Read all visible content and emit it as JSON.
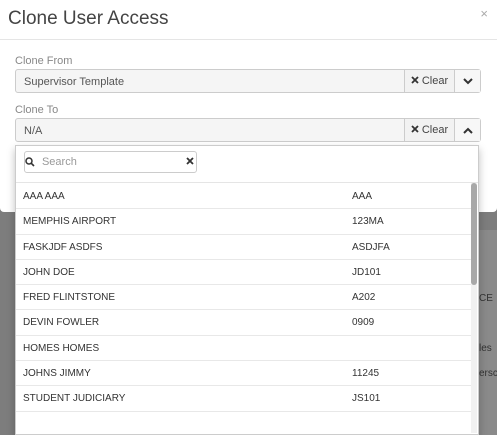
{
  "modal": {
    "title": "Clone User Access",
    "close_glyph": "×"
  },
  "clone_from": {
    "label": "Clone From",
    "value": "Supervisor Template",
    "clear_label": "Clear"
  },
  "clone_to": {
    "label": "Clone To",
    "value": "N/A",
    "clear_label": "Clear"
  },
  "dropdown": {
    "search_placeholder": "Search",
    "items": [
      {
        "name": "AAA AAA",
        "code": "AAA"
      },
      {
        "name": "MEMPHIS AIRPORT",
        "code": "123MA"
      },
      {
        "name": "FASKJDF ASDFS",
        "code": "ASDJFA"
      },
      {
        "name": "JOHN DOE",
        "code": "JD101"
      },
      {
        "name": "FRED FLINTSTONE",
        "code": "A202"
      },
      {
        "name": "DEVIN FOWLER",
        "code": "0909"
      },
      {
        "name": "HOMES HOMES",
        "code": ""
      },
      {
        "name": "JOHNS JIMMY",
        "code": "11245"
      },
      {
        "name": "STUDENT JUDICIARY",
        "code": "JS101"
      }
    ]
  },
  "background": {
    "fragments": [
      "CE",
      "les",
      "ersc"
    ]
  },
  "colors": {
    "accent_green": "#2e8b57"
  }
}
